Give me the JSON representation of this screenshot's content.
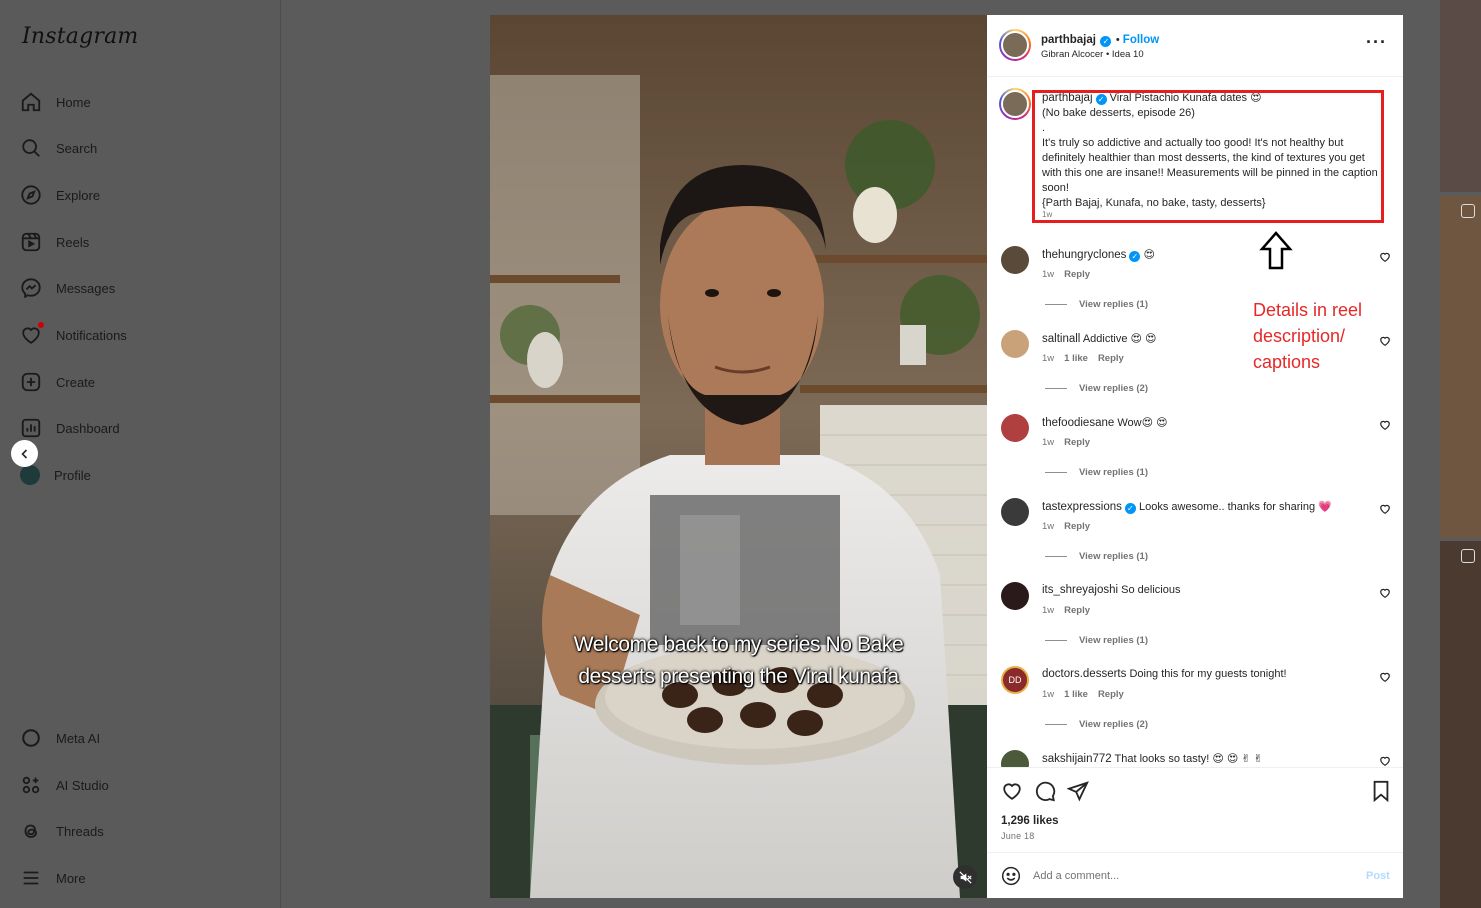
{
  "sidebar": {
    "logo": "Instagram",
    "items": [
      {
        "label": "Home",
        "icon": "home-icon"
      },
      {
        "label": "Search",
        "icon": "search-icon"
      },
      {
        "label": "Explore",
        "icon": "compass-icon"
      },
      {
        "label": "Reels",
        "icon": "reels-icon"
      },
      {
        "label": "Messages",
        "icon": "messenger-icon"
      },
      {
        "label": "Notifications",
        "icon": "heart-icon"
      },
      {
        "label": "Create",
        "icon": "plus-square-icon"
      },
      {
        "label": "Dashboard",
        "icon": "chart-icon"
      },
      {
        "label": "Profile",
        "icon": "avatar"
      }
    ],
    "bottom_items": [
      {
        "label": "Meta AI",
        "icon": "meta-ai-icon"
      },
      {
        "label": "AI Studio",
        "icon": "ai-studio-icon"
      },
      {
        "label": "Threads",
        "icon": "threads-icon"
      },
      {
        "label": "More",
        "icon": "hamburger-icon"
      }
    ]
  },
  "video": {
    "subtitle_line1": "Welcome back to my series No Bake",
    "subtitle_line2": "desserts presenting the Viral kunafa",
    "muted": true
  },
  "post": {
    "username": "parthbajaj",
    "verified": true,
    "follow_label": "Follow",
    "audio": "Gibran Alcocer • Idea 10",
    "caption": {
      "username": "parthbajaj",
      "title": "Viral Pistachio Kunafa dates 😍",
      "line2": "(No bake desserts, episode 26)",
      "line3": ".",
      "body": "It's truly so addictive and actually too good! It's not healthy but definitely healthier than most desserts, the kind of textures you get with this one are insane!! Measurements will be pinned in the caption soon!",
      "tags": "{Parth Bajaj, Kunafa, no bake, tasty, desserts}",
      "age": "1w"
    },
    "annotation": "Details in reel description/ captions",
    "comments": [
      {
        "user": "thehungryclones",
        "verified": true,
        "text": "😍",
        "age": "1w",
        "likes": "",
        "reply": "Reply",
        "view_replies": "View replies (1)",
        "avatar_color": "#5a4a3a"
      },
      {
        "user": "saltinall",
        "verified": false,
        "text": "Addictive 😍 😍",
        "age": "1w",
        "likes": "1 like",
        "reply": "Reply",
        "view_replies": "View replies (2)",
        "avatar_color": "#c9a27a"
      },
      {
        "user": "thefoodiesane",
        "verified": false,
        "text": "Wow😍 😍",
        "age": "1w",
        "likes": "",
        "reply": "Reply",
        "view_replies": "View replies (1)",
        "avatar_color": "#b04040"
      },
      {
        "user": "tastexpressions",
        "verified": true,
        "text": "Looks awesome.. thanks for sharing 💗",
        "age": "1w",
        "likes": "",
        "reply": "Reply",
        "view_replies": "View replies (1)",
        "avatar_color": "#3a3a3a"
      },
      {
        "user": "its_shreyajoshi",
        "verified": false,
        "text": "So delicious",
        "age": "1w",
        "likes": "",
        "reply": "Reply",
        "view_replies": "View replies (1)",
        "avatar_color": "#2a1a1a"
      },
      {
        "user": "doctors.desserts",
        "verified": false,
        "text": "Doing this for my guests tonight!",
        "age": "1w",
        "likes": "1 like",
        "reply": "Reply",
        "view_replies": "View replies (2)",
        "avatar_color": "#8a2a2a",
        "avatar_text": "DD"
      },
      {
        "user": "sakshijain772",
        "verified": false,
        "text": "That looks so tasty! 😍 😍 ✌ ✌",
        "age": "",
        "likes": "",
        "reply": "",
        "view_replies": "",
        "avatar_color": "#4a5a3a"
      }
    ],
    "likes": "1,296 likes",
    "date": "June 18",
    "add_comment_placeholder": "Add a comment...",
    "post_label": "Post"
  }
}
